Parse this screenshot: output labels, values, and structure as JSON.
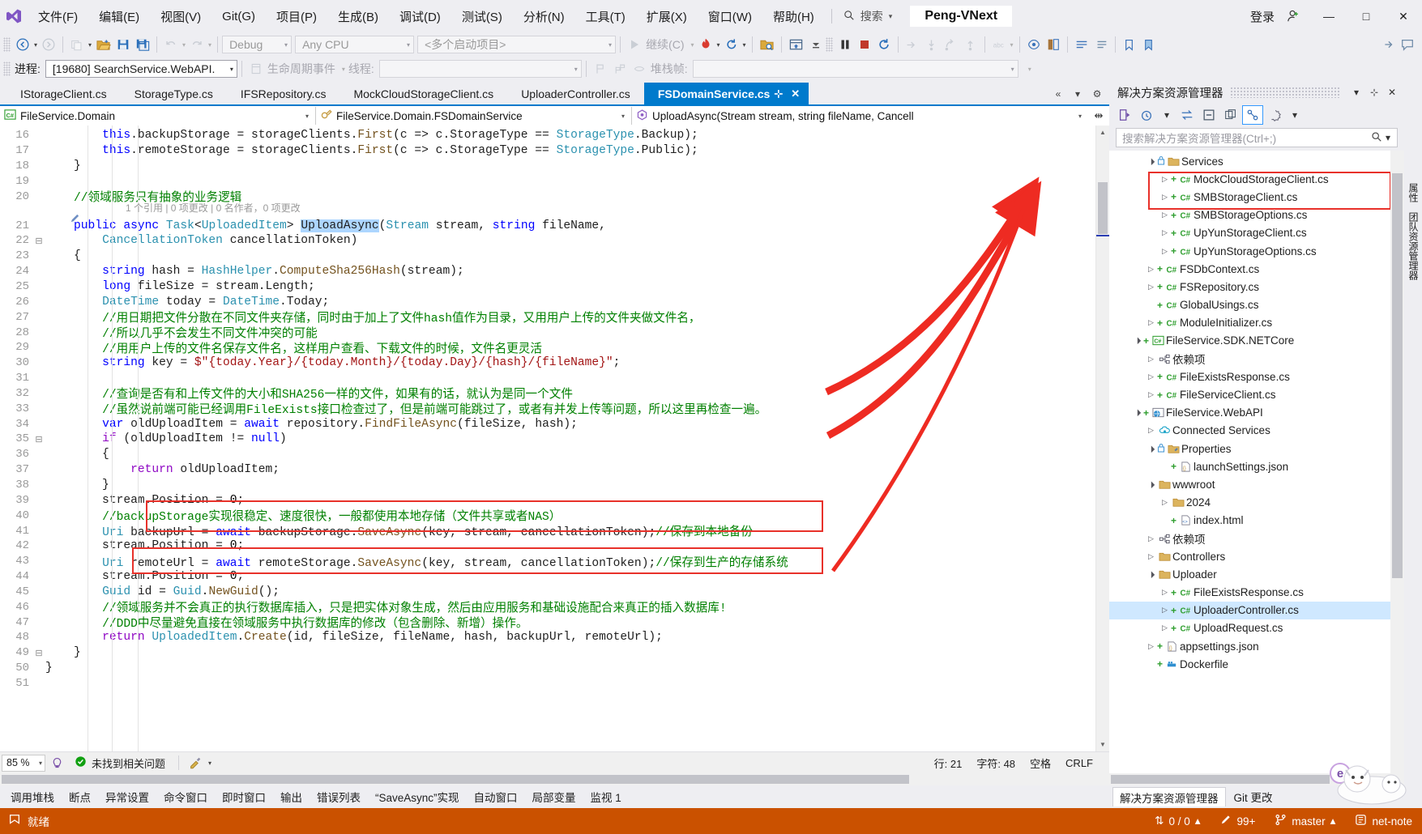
{
  "window": {
    "title": "Peng-VNext",
    "signin": "登录",
    "minimize": "—",
    "maximize": "□",
    "close": "✕"
  },
  "menu": {
    "items": [
      {
        "label": "文件(F)"
      },
      {
        "label": "编辑(E)"
      },
      {
        "label": "视图(V)"
      },
      {
        "label": "Git(G)"
      },
      {
        "label": "项目(P)"
      },
      {
        "label": "生成(B)"
      },
      {
        "label": "调试(D)"
      },
      {
        "label": "测试(S)"
      },
      {
        "label": "分析(N)"
      },
      {
        "label": "工具(T)"
      },
      {
        "label": "扩展(X)"
      },
      {
        "label": "窗口(W)"
      },
      {
        "label": "帮助(H)"
      }
    ],
    "search_placeholder": "搜索"
  },
  "toolbar": {
    "config": "Debug",
    "platform": "Any CPU",
    "startup": "<多个启动项目>",
    "continue_label": "继续(C)"
  },
  "debugbar": {
    "process_label": "进程:",
    "process_value": "[19680] SearchService.WebAPI.",
    "lifecycle_label": "生命周期事件",
    "thread_label": "线程:",
    "thread_value": "",
    "stackframe_label": "堆栈帧:",
    "stackframe_value": ""
  },
  "tabs": [
    {
      "label": "IStorageClient.cs",
      "active": false
    },
    {
      "label": "StorageType.cs",
      "active": false
    },
    {
      "label": "IFSRepository.cs",
      "active": false
    },
    {
      "label": "MockCloudStorageClient.cs",
      "active": false
    },
    {
      "label": "UploaderController.cs",
      "active": false
    },
    {
      "label": "FSDomainService.cs",
      "active": true
    }
  ],
  "navbar": {
    "project": "FileService.Domain",
    "type": "FileService.Domain.FSDomainService",
    "member": "UploadAsync(Stream stream, string fileName, Cancell"
  },
  "editor": {
    "first_line": 16,
    "codehint": "1 个引用 | 0 项更改 | 0 名作者，0 项更改",
    "lines": [
      {
        "n": 16,
        "html": "        <span class='kw'>this</span>.backupStorage = storageClients.<span class='mth'>First</span>(c =&gt; c.StorageType == <span class='type'>StorageType</span>.Backup);"
      },
      {
        "n": 17,
        "html": "        <span class='kw'>this</span>.remoteStorage = storageClients.<span class='mth'>First</span>(c =&gt; c.StorageType == <span class='type'>StorageType</span>.Public);"
      },
      {
        "n": 18,
        "html": "    }"
      },
      {
        "n": 19,
        "html": ""
      },
      {
        "n": 20,
        "html": "    <span class='cmt'>//领域服务只有抽象的业务逻辑</span>"
      },
      {
        "n": 21,
        "html": "    <span class='kw'>public</span> <span class='kw'>async</span> <span class='type'>Task</span>&lt;<span class='type'>UploadedItem</span>&gt; <span class='sel'>UploadAsync</span>(<span class='type'>Stream</span> stream, <span class='kw'>string</span> fileName,"
      },
      {
        "n": 22,
        "html": "        <span class='type'>CancellationToken</span> cancellationToken)"
      },
      {
        "n": 23,
        "html": "    {"
      },
      {
        "n": 24,
        "html": "        <span class='kw'>string</span> hash = <span class='type'>HashHelper</span>.<span class='mth'>ComputeSha256Hash</span>(stream);"
      },
      {
        "n": 25,
        "html": "        <span class='kw'>long</span> fileSize = stream.Length;"
      },
      {
        "n": 26,
        "html": "        <span class='type'>DateTime</span> today = <span class='type'>DateTime</span>.Today;"
      },
      {
        "n": 27,
        "html": "        <span class='cmt'>//用日期把文件分散在不同文件夹存储，同时由于加上了文件hash值作为目录，又用用户上传的文件夹做文件名，</span>"
      },
      {
        "n": 28,
        "html": "        <span class='cmt'>//所以几乎不会发生不同文件冲突的可能</span>"
      },
      {
        "n": 29,
        "html": "        <span class='cmt'>//用用户上传的文件名保存文件名，这样用户查看、下载文件的时候，文件名更灵活</span>"
      },
      {
        "n": 30,
        "html": "        <span class='kw'>string</span> key = <span class='str'>$\"{today.Year}/{today.Month}/{today.Day}/{hash}/{fileName}\"</span>;"
      },
      {
        "n": 31,
        "html": ""
      },
      {
        "n": 32,
        "html": "        <span class='cmt'>//查询是否有和上传文件的大小和SHA256一样的文件，如果有的话，就认为是同一个文件</span>"
      },
      {
        "n": 33,
        "html": "        <span class='cmt'>//虽然说前端可能已经调用FileExists接口检查过了，但是前端可能跳过了，或者有并发上传等问题，所以这里再检查一遍。</span>"
      },
      {
        "n": 34,
        "html": "        <span class='kw'>var</span> oldUploadItem = <span class='kw'>await</span> repository.<span class='mth'>FindFileAsync</span>(fileSize, hash);"
      },
      {
        "n": 35,
        "html": "        <span class='ctl'>if</span> (oldUploadItem != <span class='kw'>null</span>)"
      },
      {
        "n": 36,
        "html": "        {"
      },
      {
        "n": 37,
        "html": "            <span class='ctl'>return</span> oldUploadItem;"
      },
      {
        "n": 38,
        "html": "        }"
      },
      {
        "n": 39,
        "html": "        stream.Position = <span class='num'>0</span>;"
      },
      {
        "n": 40,
        "html": "        <span class='cmt'>//backupStorage实现很稳定、速度很快，一般都使用本地存储（文件共享或者NAS）</span>"
      },
      {
        "n": 41,
        "html": "        <span class='type'>Uri</span> backupUrl = <span class='kw'>await</span> backupStorage.<span class='mth'>SaveAsync</span>(key, stream, cancellationToken);<span class='cmt'>//保存到本地备份</span>"
      },
      {
        "n": 42,
        "html": "        stream.Position = <span class='num'>0</span>;"
      },
      {
        "n": 43,
        "html": "        <span class='type'>Uri</span> remoteUrl = <span class='kw'>await</span> remoteStorage.<span class='mth'>SaveAsync</span>(key, stream, cancellationToken);<span class='cmt'>//保存到生产的存储系统</span>"
      },
      {
        "n": 44,
        "html": "        stream.Position = <span class='num'>0</span>;"
      },
      {
        "n": 45,
        "html": "        <span class='type'>Guid</span> id = <span class='type'>Guid</span>.<span class='mth'>NewGuid</span>();"
      },
      {
        "n": 46,
        "html": "        <span class='cmt'>//领域服务并不会真正的执行数据库插入，只是把实体对象生成，然后由应用服务和基础设施配合来真正的插入数据库!</span>"
      },
      {
        "n": 47,
        "html": "        <span class='cmt'>//DDD中尽量避免直接在领域服务中执行数据库的修改（包含删除、新增）操作。</span>"
      },
      {
        "n": 48,
        "html": "        <span class='ctl'>return</span> <span class='type'>UploadedItem</span>.<span class='mth'>Create</span>(id, fileSize, fileName, hash, backupUrl, remoteUrl);"
      },
      {
        "n": 49,
        "html": "    }"
      },
      {
        "n": 50,
        "html": "}"
      },
      {
        "n": 51,
        "html": ""
      }
    ]
  },
  "editor_status": {
    "zoom": "85 %",
    "issues": "未找到相关问题",
    "line_label": "行: 21",
    "col_label": "字符: 48",
    "spaces": "空格",
    "eol": "CRLF"
  },
  "bottom_tabs": [
    {
      "label": "调用堆栈"
    },
    {
      "label": "断点"
    },
    {
      "label": "异常设置"
    },
    {
      "label": "命令窗口"
    },
    {
      "label": "即时窗口"
    },
    {
      "label": "输出"
    },
    {
      "label": "错误列表"
    },
    {
      "label": "“SaveAsync”实现"
    },
    {
      "label": "自动窗口"
    },
    {
      "label": "局部变量"
    },
    {
      "label": "监视 1"
    }
  ],
  "solution_explorer": {
    "title": "解决方案资源管理器",
    "search_placeholder": "搜索解决方案资源管理器(Ctrl+;)",
    "tabs": [
      {
        "label": "解决方案资源管理器",
        "active": true
      },
      {
        "label": "Git 更改",
        "active": false
      }
    ],
    "tree": [
      {
        "depth": 2,
        "twist": "▲",
        "plus": false,
        "icon": "folder-lock",
        "label": "Services",
        "selected": false
      },
      {
        "depth": 3,
        "twist": "▶",
        "plus": true,
        "icon": "cs",
        "label": "MockCloudStorageClient.cs",
        "selected": false
      },
      {
        "depth": 3,
        "twist": "▶",
        "plus": true,
        "icon": "cs",
        "label": "SMBStorageClient.cs",
        "selected": false
      },
      {
        "depth": 3,
        "twist": "▶",
        "plus": true,
        "icon": "cs",
        "label": "SMBStorageOptions.cs",
        "selected": false
      },
      {
        "depth": 3,
        "twist": "▶",
        "plus": true,
        "icon": "cs",
        "label": "UpYunStorageClient.cs",
        "selected": false
      },
      {
        "depth": 3,
        "twist": "▶",
        "plus": true,
        "icon": "cs",
        "label": "UpYunStorageOptions.cs",
        "selected": false
      },
      {
        "depth": 2,
        "twist": "▶",
        "plus": true,
        "icon": "cs",
        "label": "FSDbContext.cs",
        "selected": false
      },
      {
        "depth": 2,
        "twist": "▶",
        "plus": true,
        "icon": "cs",
        "label": "FSRepository.cs",
        "selected": false
      },
      {
        "depth": 2,
        "twist": "",
        "plus": true,
        "icon": "cs",
        "label": "GlobalUsings.cs",
        "selected": false
      },
      {
        "depth": 2,
        "twist": "▶",
        "plus": true,
        "icon": "cs",
        "label": "ModuleInitializer.cs",
        "selected": false
      },
      {
        "depth": 1,
        "twist": "▲",
        "plus": true,
        "icon": "proj-cs",
        "label": "FileService.SDK.NETCore",
        "selected": false
      },
      {
        "depth": 2,
        "twist": "▶",
        "plus": false,
        "icon": "deps",
        "label": "依赖项",
        "selected": false
      },
      {
        "depth": 2,
        "twist": "▶",
        "plus": true,
        "icon": "cs",
        "label": "FileExistsResponse.cs",
        "selected": false
      },
      {
        "depth": 2,
        "twist": "▶",
        "plus": true,
        "icon": "cs",
        "label": "FileServiceClient.cs",
        "selected": false
      },
      {
        "depth": 1,
        "twist": "▲",
        "plus": true,
        "icon": "proj-web",
        "label": "FileService.WebAPI",
        "selected": false
      },
      {
        "depth": 2,
        "twist": "▶",
        "plus": false,
        "icon": "cloud",
        "label": "Connected Services",
        "selected": false
      },
      {
        "depth": 2,
        "twist": "▲",
        "plus": false,
        "icon": "props",
        "label": "Properties",
        "selected": false
      },
      {
        "depth": 3,
        "twist": "",
        "plus": true,
        "icon": "json",
        "label": "launchSettings.json",
        "selected": false
      },
      {
        "depth": 2,
        "twist": "▲",
        "plus": false,
        "icon": "folder",
        "label": "wwwroot",
        "selected": false
      },
      {
        "depth": 3,
        "twist": "▶",
        "plus": false,
        "icon": "folder",
        "label": "2024",
        "selected": false
      },
      {
        "depth": 3,
        "twist": "",
        "plus": true,
        "icon": "html",
        "label": "index.html",
        "selected": false
      },
      {
        "depth": 2,
        "twist": "▶",
        "plus": false,
        "icon": "deps",
        "label": "依赖项",
        "selected": false
      },
      {
        "depth": 2,
        "twist": "▶",
        "plus": false,
        "icon": "folder",
        "label": "Controllers",
        "selected": false
      },
      {
        "depth": 2,
        "twist": "▲",
        "plus": false,
        "icon": "folder",
        "label": "Uploader",
        "selected": false
      },
      {
        "depth": 3,
        "twist": "▶",
        "plus": true,
        "icon": "cs",
        "label": "FileExistsResponse.cs",
        "selected": false
      },
      {
        "depth": 3,
        "twist": "▶",
        "plus": true,
        "icon": "cs",
        "label": "UploaderController.cs",
        "selected": true
      },
      {
        "depth": 3,
        "twist": "▶",
        "plus": true,
        "icon": "cs",
        "label": "UploadRequest.cs",
        "selected": false
      },
      {
        "depth": 2,
        "twist": "▶",
        "plus": true,
        "icon": "json",
        "label": "appsettings.json",
        "selected": false
      },
      {
        "depth": 2,
        "twist": "",
        "plus": true,
        "icon": "docker",
        "label": "Dockerfile",
        "selected": false
      }
    ]
  },
  "vdock": [
    {
      "label": "属性"
    },
    {
      "label": "团队资源管理器"
    }
  ],
  "statusbar": {
    "ready": "就绪",
    "changes": "0 / 0",
    "issues": "99+",
    "branch": "master",
    "repo": "net-note"
  }
}
